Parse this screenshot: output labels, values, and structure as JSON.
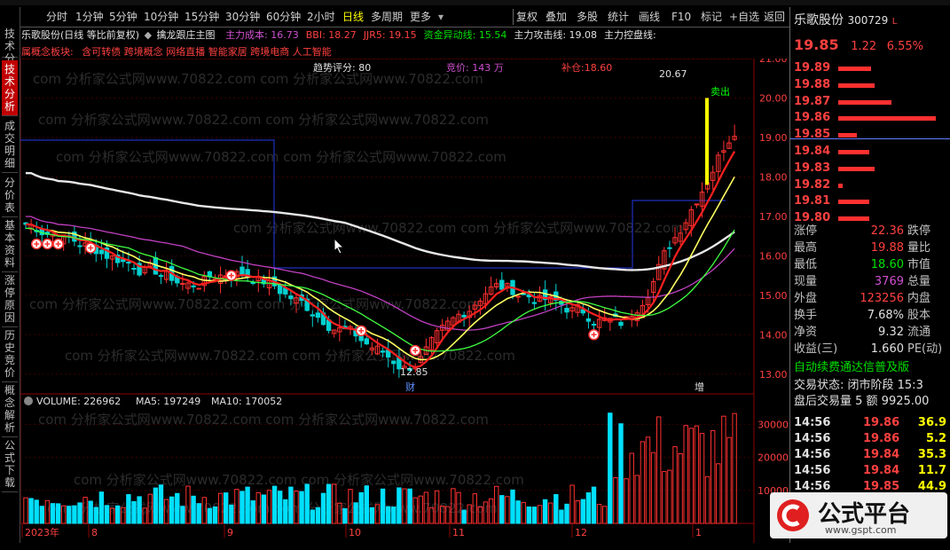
{
  "menubar": {
    "periods": [
      "分时",
      "1分钟",
      "5分钟",
      "10分钟",
      "15分钟",
      "30分钟",
      "60分钟",
      "2小时",
      "日线",
      "多周期",
      "更多"
    ],
    "active_period": "日线",
    "right_buttons": [
      "复权",
      "叠加",
      "多股",
      "统计",
      "画线",
      "F10",
      "标记",
      "自选",
      "返回"
    ]
  },
  "leftbar": {
    "tabs": [
      "技术分析",
      "成交明细",
      "分价表",
      "基本资料",
      "涨停原因",
      "历史竞价",
      "概念解析",
      "公式下载"
    ]
  },
  "chart_header": {
    "stock": "乐歌股份(日线 等比前复权)",
    "template": "擒龙跟庄主图",
    "indicators": [
      {
        "label": "主力成本: 16.73",
        "color": "#d050d0"
      },
      {
        "label": "BBI: 18.27",
        "color": "#ff4040"
      },
      {
        "label": "JJR5: 19.15",
        "color": "#ff4040"
      },
      {
        "label": "资金异动线: 15.54",
        "color": "#00e000"
      },
      {
        "label": "主力攻击线: 19.08",
        "color": "#e0e0e0"
      },
      {
        "label": "主力控盘线:",
        "color": "#e0e0e0"
      }
    ],
    "concept_prefix": "属概念板块:",
    "concepts": "含可转债 跨境概念 网络直播 智能家居 跨境电商 人工智能"
  },
  "chart_annotations": {
    "trend_score": "趋势评分: 80",
    "bid": "竞价: 143 万",
    "replenish": "补仓:18.60",
    "high_label": "20.67",
    "low_label": "12.85",
    "sell_label": "卖出",
    "cai_label": "财",
    "zeng_label": "增"
  },
  "price_axis": [
    "21.00",
    "20.00",
    "19.00",
    "18.00",
    "17.00",
    "16.00",
    "15.00",
    "14.00",
    "13.00"
  ],
  "volume_header": {
    "volume": "VOLUME: 226962",
    "ma5": "MA5: 197249",
    "ma10": "MA10: 170052"
  },
  "volume_axis": [
    "30000",
    "20000",
    "10000"
  ],
  "time_axis": [
    "2023年",
    "8",
    "9",
    "10",
    "11",
    "12",
    "1"
  ],
  "watermark": "com 分析家公式网www.70822.com",
  "quote": {
    "name": "乐歌股份",
    "code": "300729",
    "flag": "L",
    "price": "19.85",
    "change": "1.22",
    "change_pct": "6.55%",
    "levels": [
      "19.89",
      "19.88",
      "19.87",
      "19.86",
      "19.85",
      "19.84",
      "19.83",
      "19.82",
      "19.81",
      "19.80"
    ],
    "depth": [
      0.32,
      0.36,
      0.52,
      0.96,
      0.18,
      0.3,
      0.36,
      0.04,
      0.3,
      0.3
    ],
    "stats": [
      {
        "l1": "涨停",
        "v1": "22.36",
        "c1": "red",
        "l2": "跌停"
      },
      {
        "l1": "最高",
        "v1": "19.88",
        "c1": "red",
        "l2": "量比"
      },
      {
        "l1": "最低",
        "v1": "18.60",
        "c1": "grn",
        "l2": "市值"
      },
      {
        "l1": "现量",
        "v1": "3769",
        "c1": "mag",
        "l2": "总量"
      },
      {
        "l1": "外盘",
        "v1": "123256",
        "c1": "red",
        "l2": "内盘"
      },
      {
        "l1": "换手",
        "v1": "7.68%",
        "c1": "wht",
        "l2": "股本"
      },
      {
        "l1": "净资",
        "v1": "9.32",
        "c1": "wht",
        "l2": "流通"
      },
      {
        "l1": "收益(三)",
        "v1": "1.660",
        "c1": "wht",
        "l2": "PE(动)"
      }
    ],
    "promo": "自动续费通达信普及版",
    "trade_status": "交易状态: 闭市阶段 15:3",
    "after_hours": "盘后交易量 5 额 9925.00",
    "ticks": [
      {
        "t": "14:56",
        "p": "19.86",
        "v": "36.9"
      },
      {
        "t": "14:56",
        "p": "19.86",
        "v": "5.2"
      },
      {
        "t": "14:56",
        "p": "19.84",
        "v": "35.3"
      },
      {
        "t": "14:56",
        "p": "19.84",
        "v": "11.7"
      },
      {
        "t": "14:56",
        "p": "19.85",
        "v": "44.9"
      }
    ]
  },
  "logo": {
    "text": "公式平台",
    "url": "www.gspt.com"
  }
}
